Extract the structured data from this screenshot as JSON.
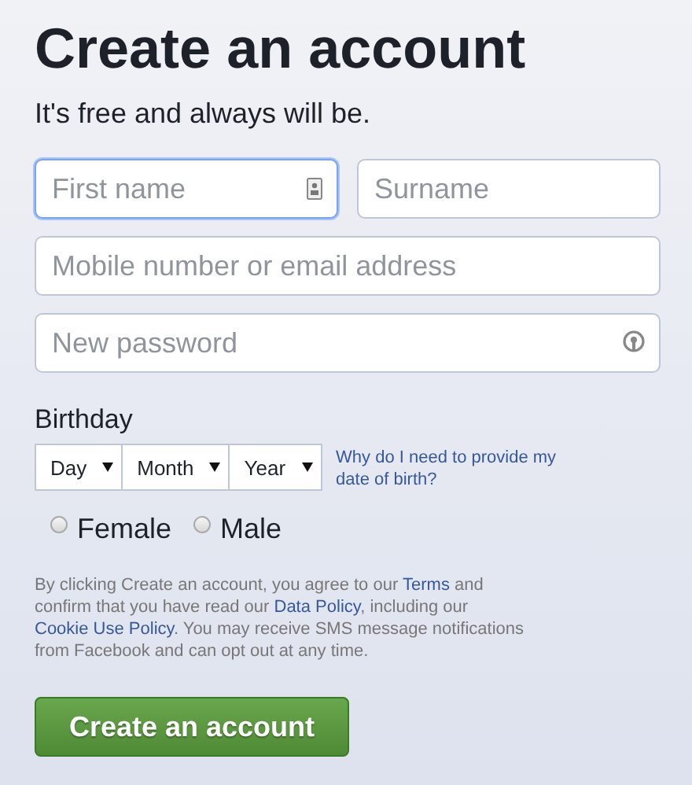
{
  "title": "Create an account",
  "subtitle": "It's free and always will be.",
  "fields": [
    {
      "kind": "name",
      "placeholder": "First name",
      "focused": true,
      "icon": true
    },
    {
      "kind": "name",
      "placeholder": "Surname",
      "focused": false,
      "icon": false
    },
    {
      "kind": "wide",
      "placeholder": "Mobile number or email address",
      "focused": false,
      "icon": false
    },
    {
      "kind": "password",
      "placeholder": "New password",
      "focused": false,
      "icon": true
    }
  ],
  "birthday": {
    "label": "Birthday",
    "selects": [
      {
        "value": "Day"
      },
      {
        "value": "Month"
      },
      {
        "value": "Year"
      }
    ],
    "help_link": "Why do I need to provide my date of birth?"
  },
  "genders": [
    {
      "label": "Female",
      "selected": false
    },
    {
      "label": "Male",
      "selected": false
    }
  ],
  "legal": [
    {
      "kind": "text",
      "text": "By clicking Create an account, you agree to our "
    },
    {
      "kind": "link",
      "text": "Terms"
    },
    {
      "kind": "text",
      "text": " and confirm that you have read our "
    },
    {
      "kind": "link",
      "text": "Data Policy"
    },
    {
      "kind": "text",
      "text": ", including our "
    },
    {
      "kind": "link",
      "text": "Cookie Use Policy"
    },
    {
      "kind": "text",
      "text": ". You may receive SMS message notifications from Facebook and can opt out at any time."
    }
  ],
  "submit": "Create an account"
}
